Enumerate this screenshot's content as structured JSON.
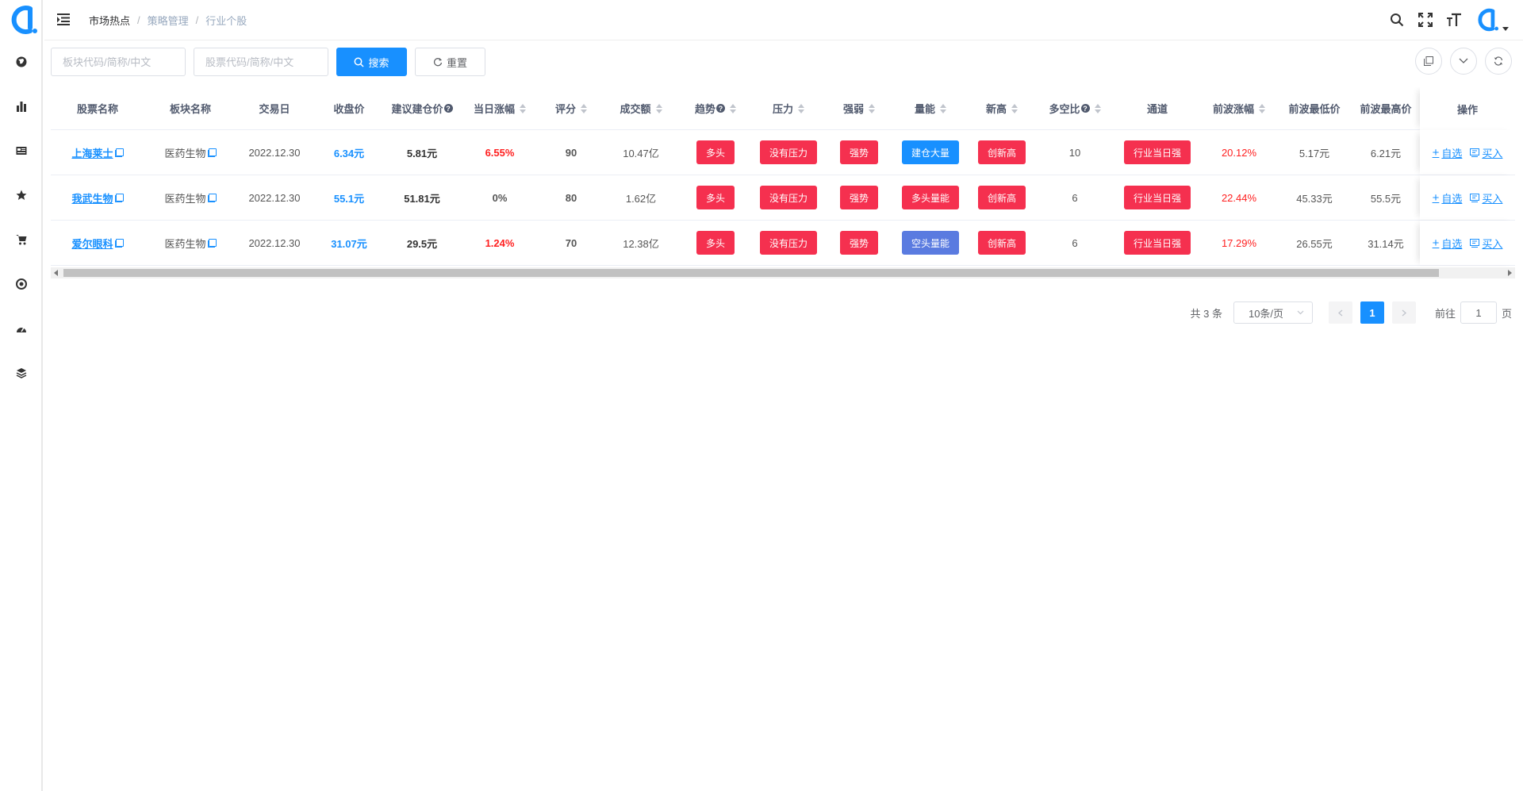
{
  "colors": {
    "primary": "#1890ff",
    "tag_red": "#f5304f",
    "tag_blue": "#1890ff",
    "tag_indigo": "#5a7be0",
    "up_red": "#ff2020"
  },
  "sidebar": {
    "items": [
      {
        "icon": "globe-icon"
      },
      {
        "icon": "bar-chart-icon"
      },
      {
        "icon": "news-icon"
      },
      {
        "icon": "star-icon"
      },
      {
        "icon": "cart-icon"
      },
      {
        "icon": "target-icon"
      },
      {
        "icon": "dashboard-icon"
      },
      {
        "icon": "layers-icon"
      }
    ]
  },
  "breadcrumb": {
    "items": [
      "市场热点",
      "策略管理",
      "行业个股"
    ],
    "separator": "/"
  },
  "filters": {
    "sector_placeholder": "板块代码/简称/中文",
    "stock_placeholder": "股票代码/简称/中文",
    "search_label": "搜索",
    "reset_label": "重置"
  },
  "table": {
    "columns": [
      "股票名称",
      "板块名称",
      "交易日",
      "收盘价",
      "建议建仓价",
      "当日涨幅",
      "评分",
      "成交额",
      "趋势",
      "压力",
      "强弱",
      "量能",
      "新高",
      "多空比",
      "通道",
      "前波涨幅",
      "前波最低价",
      "前波最高价",
      "操作"
    ],
    "rows": [
      {
        "name": "上海莱士",
        "sector": "医药生物",
        "date": "2022.12.30",
        "close": "6.34元",
        "suggest": "5.81元",
        "change": "6.55%",
        "score": "90",
        "amount": "10.47亿",
        "trend": "多头",
        "pressure": "没有压力",
        "strength": "强势",
        "volume": "建仓大量",
        "volume_color": "#1890ff",
        "high": "创新高",
        "ratio": "10",
        "channel": "行业当日强",
        "wave_change": "20.12%",
        "wave_low": "5.17元",
        "wave_high": "6.21元"
      },
      {
        "name": "我武生物",
        "sector": "医药生物",
        "date": "2022.12.30",
        "close": "55.1元",
        "suggest": "51.81元",
        "change": "0%",
        "score": "80",
        "amount": "1.62亿",
        "trend": "多头",
        "pressure": "没有压力",
        "strength": "强势",
        "volume": "多头量能",
        "volume_color": "#f5304f",
        "high": "创新高",
        "ratio": "6",
        "channel": "行业当日强",
        "wave_change": "22.44%",
        "wave_low": "45.33元",
        "wave_high": "55.5元"
      },
      {
        "name": "爱尔眼科",
        "sector": "医药生物",
        "date": "2022.12.30",
        "close": "31.07元",
        "suggest": "29.5元",
        "change": "1.24%",
        "score": "70",
        "amount": "12.38亿",
        "trend": "多头",
        "pressure": "没有压力",
        "strength": "强势",
        "volume": "空头量能",
        "volume_color": "#5a7be0",
        "high": "创新高",
        "ratio": "6",
        "channel": "行业当日强",
        "wave_change": "17.29%",
        "wave_low": "26.55元",
        "wave_high": "31.14元"
      }
    ],
    "ops": {
      "watch": "自选",
      "buy": "买入"
    }
  },
  "pagination": {
    "total": "共 3 条",
    "page_size": "10条/页",
    "current": "1",
    "goto_prefix": "前往",
    "goto_value": "1",
    "goto_suffix": "页"
  }
}
